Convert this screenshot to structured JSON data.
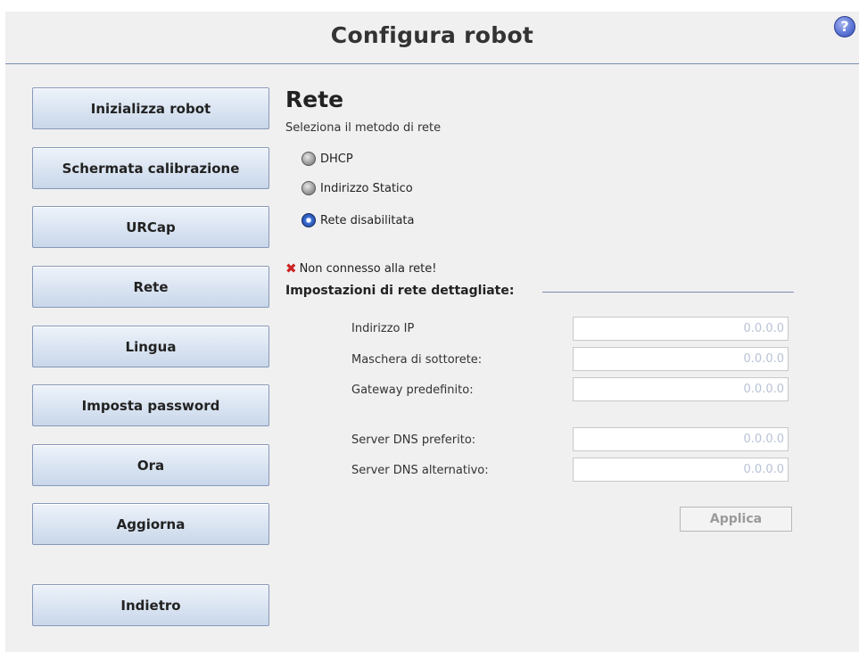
{
  "header": {
    "title": "Configura robot",
    "help_label": "?"
  },
  "nav": {
    "items": [
      {
        "label": "Inizializza robot"
      },
      {
        "label": "Schermata calibrazione"
      },
      {
        "label": "URCap"
      },
      {
        "label": "Rete"
      },
      {
        "label": "Lingua"
      },
      {
        "label": "Imposta password"
      },
      {
        "label": "Ora"
      },
      {
        "label": "Aggiorna"
      }
    ],
    "back_label": "Indietro"
  },
  "network": {
    "title": "Rete",
    "subtitle": "Seleziona il metodo di rete",
    "options": [
      {
        "label": "DHCP",
        "selected": false
      },
      {
        "label": "Indirizzo Statico",
        "selected": false
      },
      {
        "label": "Rete disabilitata",
        "selected": true
      }
    ],
    "status": "Non connesso alla rete!",
    "details_title": "Impostazioni di rete dettagliate:",
    "fields": [
      {
        "label": "Indirizzo IP",
        "value": "0.0.0.0"
      },
      {
        "label": "Maschera di sottorete:",
        "value": "0.0.0.0"
      },
      {
        "label": "Gateway predefinito:",
        "value": "0.0.0.0"
      },
      {
        "label": "Server DNS preferito:",
        "value": "0.0.0.0"
      },
      {
        "label": "Server DNS alternativo:",
        "value": "0.0.0.0"
      }
    ],
    "apply_label": "Applica"
  }
}
